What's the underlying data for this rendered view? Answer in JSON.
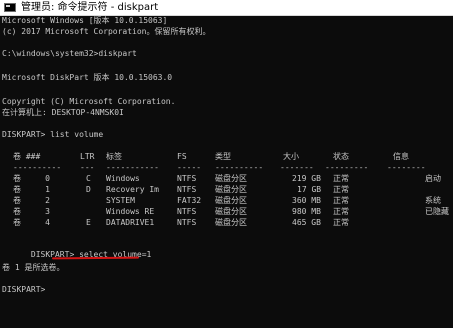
{
  "window": {
    "title": "管理员: 命令提示符 - diskpart"
  },
  "console": {
    "lines": [
      "Microsoft Windows [版本 10.0.15063]",
      "(c) 2017 Microsoft Corporation。保留所有权利。",
      "",
      "C:\\windows\\system32>diskpart",
      "",
      "Microsoft DiskPart 版本 10.0.15063.0",
      "",
      "Copyright (C) Microsoft Corporation.",
      "在计算机上: DESKTOP-4NMSK0I",
      "",
      "DISKPART> list volume"
    ],
    "table": {
      "headers": [
        "卷 ###",
        "LTR",
        "标签",
        "FS",
        "类型",
        "大小",
        "状态",
        "信息"
      ],
      "separators": [
        "----------",
        "---",
        "-----------",
        "-----",
        "----------",
        "-------",
        "---------",
        "--------"
      ],
      "rows": [
        [
          "卷     0",
          "C",
          "Windows",
          "NTFS",
          "磁盘分区",
          "219 GB",
          "正常",
          "启动"
        ],
        [
          "卷     1",
          "D",
          "Recovery Im",
          "NTFS",
          "磁盘分区",
          "17 GB",
          "正常",
          ""
        ],
        [
          "卷     2",
          "",
          "SYSTEM",
          "FAT32",
          "磁盘分区",
          "360 MB",
          "正常",
          "系统"
        ],
        [
          "卷     3",
          "",
          "Windows RE",
          "NTFS",
          "磁盘分区",
          "980 MB",
          "正常",
          "已隐藏"
        ],
        [
          "卷     4",
          "E",
          "DATADRIVE1",
          "NTFS",
          "磁盘分区",
          "465 GB",
          "正常",
          ""
        ]
      ]
    },
    "prompt_prefix": "DISKPART> ",
    "command": "select volume=1",
    "result": "卷 1 是所选卷。",
    "final_prompt": "DISKPART>"
  },
  "colors": {
    "background": "#0c0c0c",
    "text": "#c8c8c8",
    "underline": "#d11414"
  }
}
